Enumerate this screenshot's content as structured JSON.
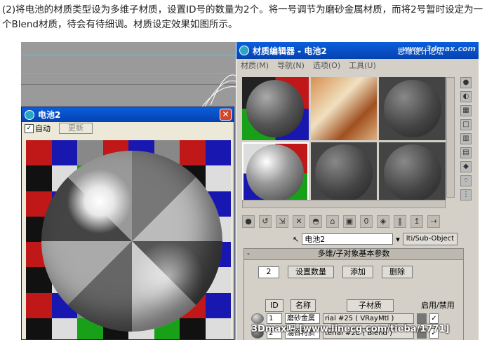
{
  "caption": "(2)将电池的材质类型设为多维子材质，设置ID号的数量为2个。将一号调节为磨砂金属材质，而将2号暂时设定为一个Blend材质，待会有待细调。材质设定效果如图所示。",
  "render_window": {
    "title": "电池2",
    "close": "✕",
    "auto_label": "自动",
    "auto_checked": "✓",
    "update_label": "更新"
  },
  "material_editor": {
    "title": "材质编辑器 - 电池2",
    "forum": "思缘设计论坛",
    "logo": "www.3dmax.com",
    "menu": [
      "材质(M)",
      "导航(N)",
      "选项(O)",
      "工具(U)"
    ],
    "material_name": "电池2",
    "type_button": "lti/Sub-Object",
    "rollout_title": "多维/子对象基本参数",
    "rollout_toggle": "-",
    "count": "2",
    "set_count_button": "设置数量",
    "add_button": "添加",
    "delete_button": "删除",
    "col_id": "ID",
    "col_name": "名称",
    "col_submaterial": "子材质",
    "col_enable": "启用/禁用",
    "rows": [
      {
        "id": "1",
        "name": "磨砂金属",
        "material": "rial #25  ( VRayMtl )",
        "check": "✓"
      },
      {
        "id": "2",
        "name": "混合材质",
        "material": "terial #26  ( Blend )",
        "check": "✓"
      }
    ]
  },
  "watermark": "3Dmax吧  [www.linecg.com/tieba/1771]",
  "colors": {
    "titlebar": "#0a5fdc",
    "red": "#c01818",
    "green": "#18a018",
    "blue": "#1818b0"
  }
}
